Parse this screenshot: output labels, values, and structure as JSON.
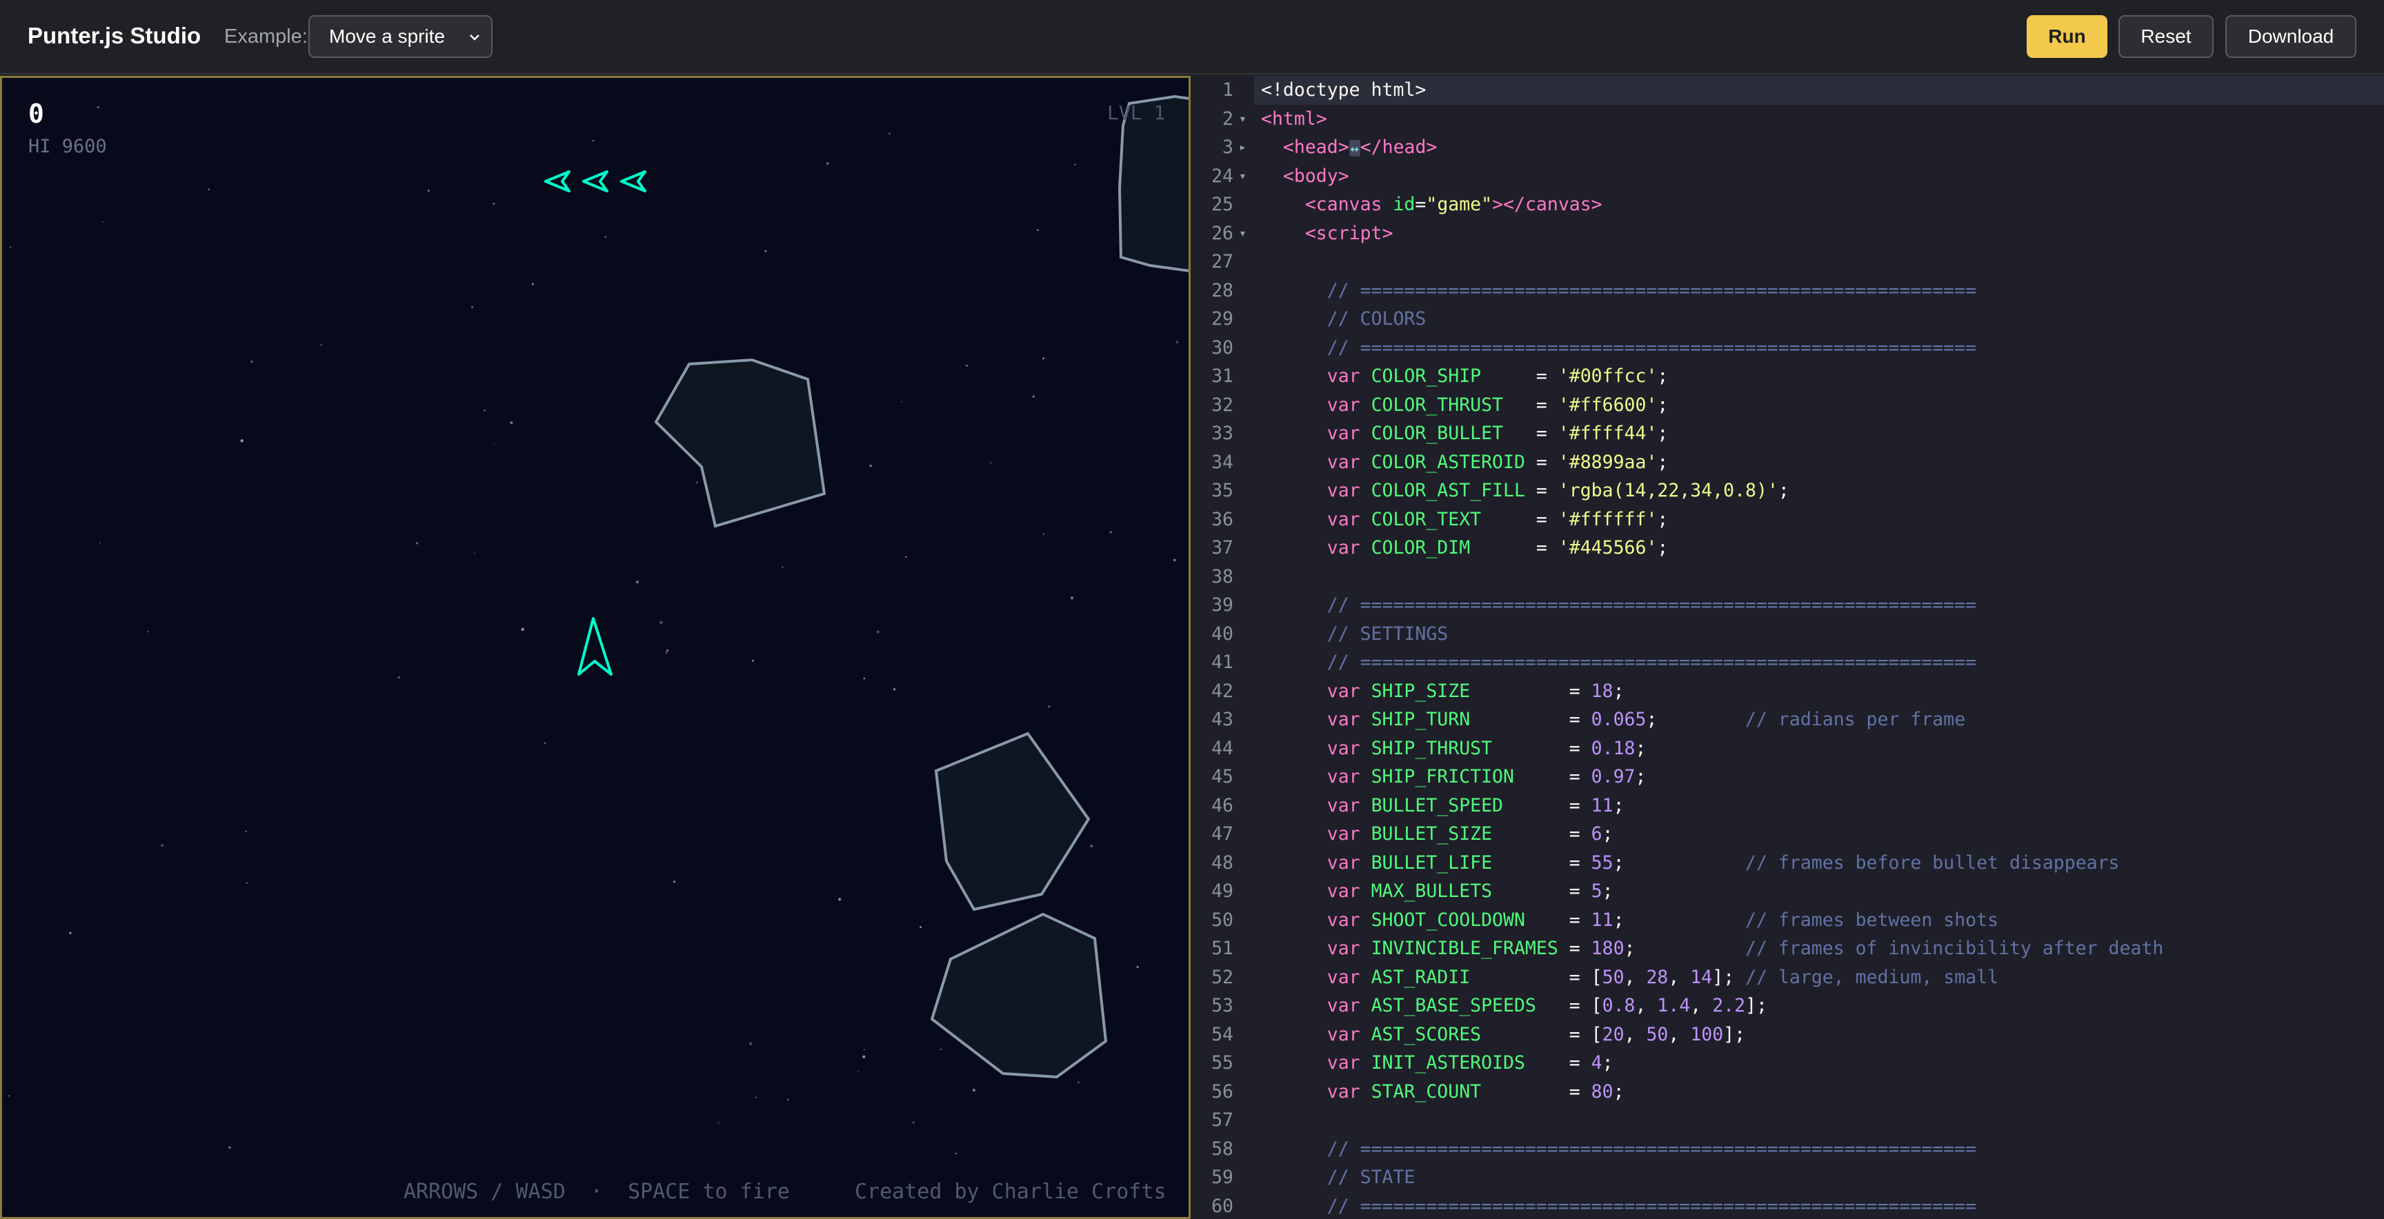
{
  "toolbar": {
    "brand": "Punter.js Studio",
    "example_label": "Example:",
    "example_selected": "Move a sprite",
    "run_label": "Run",
    "reset_label": "Reset",
    "download_label": "Download"
  },
  "game": {
    "score": "0",
    "hi_score": "HI 9600",
    "level": "LVL 1",
    "lives_count": 3,
    "help": "ARROWS / WASD  ·  SPACE to fire",
    "credit": "Created by Charlie Crofts",
    "colors": {
      "ship": "#00ffcc",
      "asteroid": "#8899aa",
      "asteroid_fill": "#0e1622",
      "background": "#070a1a"
    }
  },
  "editor": {
    "active_line": 1,
    "lines": [
      {
        "n": "1",
        "fold": "",
        "tokens": [
          [
            "plain",
            "<!doctype html>"
          ]
        ]
      },
      {
        "n": "2",
        "fold": "▾",
        "tokens": [
          [
            "tag",
            "<html>"
          ]
        ]
      },
      {
        "n": "3",
        "fold": "▸",
        "tokens": [
          [
            "plain",
            "  "
          ],
          [
            "tag",
            "<head>"
          ],
          [
            "mark",
            "↔"
          ],
          [
            "tag",
            "</head>"
          ]
        ]
      },
      {
        "n": "24",
        "fold": "▾",
        "tokens": [
          [
            "plain",
            "  "
          ],
          [
            "tag",
            "<body>"
          ]
        ]
      },
      {
        "n": "25",
        "fold": "",
        "tokens": [
          [
            "plain",
            "    "
          ],
          [
            "tag",
            "<canvas "
          ],
          [
            "attr",
            "id"
          ],
          [
            "pun",
            "="
          ],
          [
            "str",
            "\"game\""
          ],
          [
            "tag",
            "></canvas>"
          ]
        ]
      },
      {
        "n": "26",
        "fold": "▾",
        "tokens": [
          [
            "plain",
            "    "
          ],
          [
            "tag",
            "<script>"
          ]
        ]
      },
      {
        "n": "27",
        "fold": "",
        "tokens": []
      },
      {
        "n": "28",
        "fold": "",
        "tokens": [
          [
            "cmt",
            "      // ========================================================"
          ]
        ]
      },
      {
        "n": "29",
        "fold": "",
        "tokens": [
          [
            "cmt",
            "      // COLORS"
          ]
        ]
      },
      {
        "n": "30",
        "fold": "",
        "tokens": [
          [
            "cmt",
            "      // ========================================================"
          ]
        ]
      },
      {
        "n": "31",
        "fold": "",
        "tokens": [
          [
            "plain",
            "      "
          ],
          [
            "kw",
            "var "
          ],
          [
            "var",
            "COLOR_SHIP    "
          ],
          [
            "pun",
            " = "
          ],
          [
            "str",
            "'#00ffcc'"
          ],
          [
            "pun",
            ";"
          ]
        ]
      },
      {
        "n": "32",
        "fold": "",
        "tokens": [
          [
            "plain",
            "      "
          ],
          [
            "kw",
            "var "
          ],
          [
            "var",
            "COLOR_THRUST  "
          ],
          [
            "pun",
            " = "
          ],
          [
            "str",
            "'#ff6600'"
          ],
          [
            "pun",
            ";"
          ]
        ]
      },
      {
        "n": "33",
        "fold": "",
        "tokens": [
          [
            "plain",
            "      "
          ],
          [
            "kw",
            "var "
          ],
          [
            "var",
            "COLOR_BULLET  "
          ],
          [
            "pun",
            " = "
          ],
          [
            "str",
            "'#ffff44'"
          ],
          [
            "pun",
            ";"
          ]
        ]
      },
      {
        "n": "34",
        "fold": "",
        "tokens": [
          [
            "plain",
            "      "
          ],
          [
            "kw",
            "var "
          ],
          [
            "var",
            "COLOR_ASTEROID"
          ],
          [
            "pun",
            " = "
          ],
          [
            "str",
            "'#8899aa'"
          ],
          [
            "pun",
            ";"
          ]
        ]
      },
      {
        "n": "35",
        "fold": "",
        "tokens": [
          [
            "plain",
            "      "
          ],
          [
            "kw",
            "var "
          ],
          [
            "var",
            "COLOR_AST_FILL"
          ],
          [
            "pun",
            " = "
          ],
          [
            "str",
            "'rgba(14,22,34,0.8)'"
          ],
          [
            "pun",
            ";"
          ]
        ]
      },
      {
        "n": "36",
        "fold": "",
        "tokens": [
          [
            "plain",
            "      "
          ],
          [
            "kw",
            "var "
          ],
          [
            "var",
            "COLOR_TEXT    "
          ],
          [
            "pun",
            " = "
          ],
          [
            "str",
            "'#ffffff'"
          ],
          [
            "pun",
            ";"
          ]
        ]
      },
      {
        "n": "37",
        "fold": "",
        "tokens": [
          [
            "plain",
            "      "
          ],
          [
            "kw",
            "var "
          ],
          [
            "var",
            "COLOR_DIM     "
          ],
          [
            "pun",
            " = "
          ],
          [
            "str",
            "'#445566'"
          ],
          [
            "pun",
            ";"
          ]
        ]
      },
      {
        "n": "38",
        "fold": "",
        "tokens": []
      },
      {
        "n": "39",
        "fold": "",
        "tokens": [
          [
            "cmt",
            "      // ========================================================"
          ]
        ]
      },
      {
        "n": "40",
        "fold": "",
        "tokens": [
          [
            "cmt",
            "      // SETTINGS"
          ]
        ]
      },
      {
        "n": "41",
        "fold": "",
        "tokens": [
          [
            "cmt",
            "      // ========================================================"
          ]
        ]
      },
      {
        "n": "42",
        "fold": "",
        "tokens": [
          [
            "plain",
            "      "
          ],
          [
            "kw",
            "var "
          ],
          [
            "var",
            "SHIP_SIZE         "
          ],
          [
            "pun",
            "= "
          ],
          [
            "num",
            "18"
          ],
          [
            "pun",
            ";"
          ]
        ]
      },
      {
        "n": "43",
        "fold": "",
        "tokens": [
          [
            "plain",
            "      "
          ],
          [
            "kw",
            "var "
          ],
          [
            "var",
            "SHIP_TURN         "
          ],
          [
            "pun",
            "= "
          ],
          [
            "num",
            "0.065"
          ],
          [
            "pun",
            ";"
          ],
          [
            "cmt",
            "        // radians per frame"
          ]
        ]
      },
      {
        "n": "44",
        "fold": "",
        "tokens": [
          [
            "plain",
            "      "
          ],
          [
            "kw",
            "var "
          ],
          [
            "var",
            "SHIP_THRUST       "
          ],
          [
            "pun",
            "= "
          ],
          [
            "num",
            "0.18"
          ],
          [
            "pun",
            ";"
          ]
        ]
      },
      {
        "n": "45",
        "fold": "",
        "tokens": [
          [
            "plain",
            "      "
          ],
          [
            "kw",
            "var "
          ],
          [
            "var",
            "SHIP_FRICTION     "
          ],
          [
            "pun",
            "= "
          ],
          [
            "num",
            "0.97"
          ],
          [
            "pun",
            ";"
          ]
        ]
      },
      {
        "n": "46",
        "fold": "",
        "tokens": [
          [
            "plain",
            "      "
          ],
          [
            "kw",
            "var "
          ],
          [
            "var",
            "BULLET_SPEED      "
          ],
          [
            "pun",
            "= "
          ],
          [
            "num",
            "11"
          ],
          [
            "pun",
            ";"
          ]
        ]
      },
      {
        "n": "47",
        "fold": "",
        "tokens": [
          [
            "plain",
            "      "
          ],
          [
            "kw",
            "var "
          ],
          [
            "var",
            "BULLET_SIZE       "
          ],
          [
            "pun",
            "= "
          ],
          [
            "num",
            "6"
          ],
          [
            "pun",
            ";"
          ]
        ]
      },
      {
        "n": "48",
        "fold": "",
        "tokens": [
          [
            "plain",
            "      "
          ],
          [
            "kw",
            "var "
          ],
          [
            "var",
            "BULLET_LIFE       "
          ],
          [
            "pun",
            "= "
          ],
          [
            "num",
            "55"
          ],
          [
            "pun",
            ";"
          ],
          [
            "cmt",
            "           // frames before bullet disappears"
          ]
        ]
      },
      {
        "n": "49",
        "fold": "",
        "tokens": [
          [
            "plain",
            "      "
          ],
          [
            "kw",
            "var "
          ],
          [
            "var",
            "MAX_BULLETS       "
          ],
          [
            "pun",
            "= "
          ],
          [
            "num",
            "5"
          ],
          [
            "pun",
            ";"
          ]
        ]
      },
      {
        "n": "50",
        "fold": "",
        "tokens": [
          [
            "plain",
            "      "
          ],
          [
            "kw",
            "var "
          ],
          [
            "var",
            "SHOOT_COOLDOWN    "
          ],
          [
            "pun",
            "= "
          ],
          [
            "num",
            "11"
          ],
          [
            "pun",
            ";"
          ],
          [
            "cmt",
            "           // frames between shots"
          ]
        ]
      },
      {
        "n": "51",
        "fold": "",
        "tokens": [
          [
            "plain",
            "      "
          ],
          [
            "kw",
            "var "
          ],
          [
            "var",
            "INVINCIBLE_FRAMES "
          ],
          [
            "pun",
            "= "
          ],
          [
            "num",
            "180"
          ],
          [
            "pun",
            ";"
          ],
          [
            "cmt",
            "          // frames of invincibility after death"
          ]
        ]
      },
      {
        "n": "52",
        "fold": "",
        "tokens": [
          [
            "plain",
            "      "
          ],
          [
            "kw",
            "var "
          ],
          [
            "var",
            "AST_RADII         "
          ],
          [
            "pun",
            "= ["
          ],
          [
            "num",
            "50"
          ],
          [
            "pun",
            ", "
          ],
          [
            "num",
            "28"
          ],
          [
            "pun",
            ", "
          ],
          [
            "num",
            "14"
          ],
          [
            "pun",
            "];"
          ],
          [
            "cmt",
            " // large, medium, small"
          ]
        ]
      },
      {
        "n": "53",
        "fold": "",
        "tokens": [
          [
            "plain",
            "      "
          ],
          [
            "kw",
            "var "
          ],
          [
            "var",
            "AST_BASE_SPEEDS   "
          ],
          [
            "pun",
            "= ["
          ],
          [
            "num",
            "0.8"
          ],
          [
            "pun",
            ", "
          ],
          [
            "num",
            "1.4"
          ],
          [
            "pun",
            ", "
          ],
          [
            "num",
            "2.2"
          ],
          [
            "pun",
            "];"
          ]
        ]
      },
      {
        "n": "54",
        "fold": "",
        "tokens": [
          [
            "plain",
            "      "
          ],
          [
            "kw",
            "var "
          ],
          [
            "var",
            "AST_SCORES        "
          ],
          [
            "pun",
            "= ["
          ],
          [
            "num",
            "20"
          ],
          [
            "pun",
            ", "
          ],
          [
            "num",
            "50"
          ],
          [
            "pun",
            ", "
          ],
          [
            "num",
            "100"
          ],
          [
            "pun",
            "];"
          ]
        ]
      },
      {
        "n": "55",
        "fold": "",
        "tokens": [
          [
            "plain",
            "      "
          ],
          [
            "kw",
            "var "
          ],
          [
            "var",
            "INIT_ASTEROIDS    "
          ],
          [
            "pun",
            "= "
          ],
          [
            "num",
            "4"
          ],
          [
            "pun",
            ";"
          ]
        ]
      },
      {
        "n": "56",
        "fold": "",
        "tokens": [
          [
            "plain",
            "      "
          ],
          [
            "kw",
            "var "
          ],
          [
            "var",
            "STAR_COUNT        "
          ],
          [
            "pun",
            "= "
          ],
          [
            "num",
            "80"
          ],
          [
            "pun",
            ";"
          ]
        ]
      },
      {
        "n": "57",
        "fold": "",
        "tokens": []
      },
      {
        "n": "58",
        "fold": "",
        "tokens": [
          [
            "cmt",
            "      // ========================================================"
          ]
        ]
      },
      {
        "n": "59",
        "fold": "",
        "tokens": [
          [
            "cmt",
            "      // STATE"
          ]
        ]
      },
      {
        "n": "60",
        "fold": "",
        "tokens": [
          [
            "cmt",
            "      // ========================================================"
          ]
        ]
      }
    ]
  }
}
